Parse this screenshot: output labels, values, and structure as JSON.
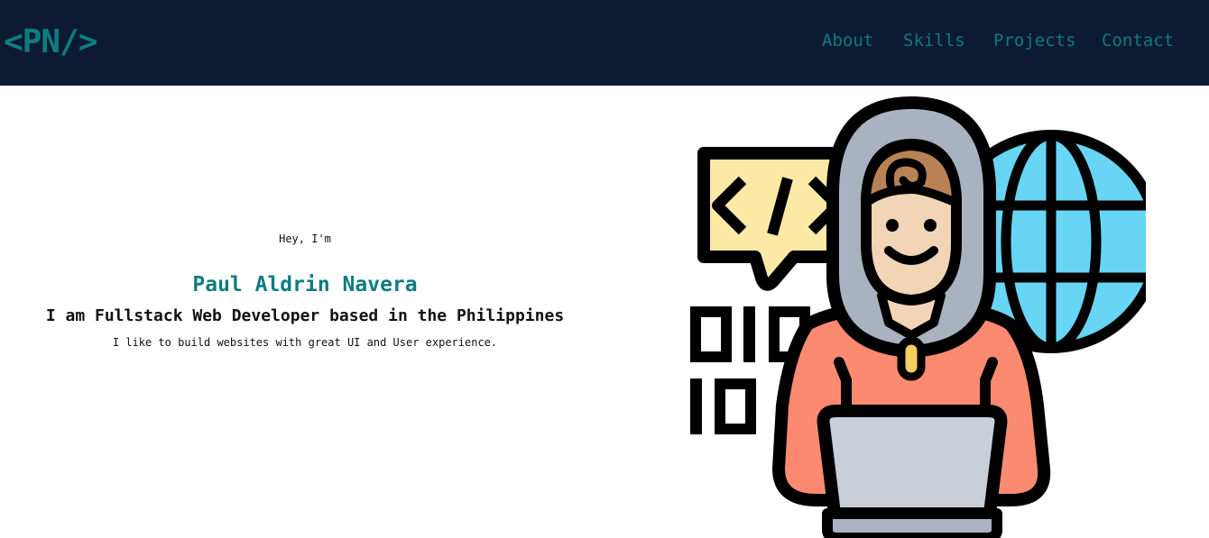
{
  "header": {
    "logo": "<PN/>",
    "nav": [
      {
        "label": "About"
      },
      {
        "label": "Skills"
      },
      {
        "label": "Projects"
      },
      {
        "label": "Contact"
      }
    ]
  },
  "hero": {
    "greeting": "Hey, I'm",
    "name": "Paul Aldrin Navera",
    "tagline": "I am Fullstack Web Developer based in the Philippines",
    "description": "I like to build websites with great UI and User experience.",
    "illustration": {
      "icon": "developer-with-laptop-icon",
      "speech_bubble_text": "</>",
      "binary_digits": [
        "01",
        "10"
      ]
    }
  },
  "colors": {
    "navbar_bg": "#0c1a32",
    "accent": "#0e7c80",
    "text": "#111111",
    "background": "#ffffff"
  }
}
